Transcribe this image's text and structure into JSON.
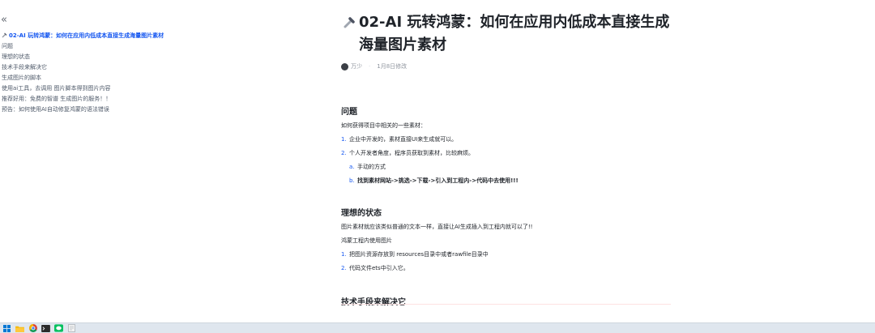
{
  "outline": {
    "collapse_glyph": "«",
    "items": [
      {
        "label": "02-AI 玩转鸿蒙：如何在应用内低成本直接生成海量图片素材"
      },
      {
        "label": "问题"
      },
      {
        "label": "理想的状态"
      },
      {
        "label": "技术手段来解决它"
      },
      {
        "label": "生成图片的脚本"
      },
      {
        "label": "使用ai工具，去调用 图片脚本得到图片内容"
      },
      {
        "label": "推荐好用：免费的智谱 生成图片的服务！！"
      },
      {
        "label": "预告：如何使用AI自动修复鸿蒙的语法错误"
      }
    ]
  },
  "doc": {
    "title": "02-AI 玩转鸿蒙：如何在应用内低成本直接生成海量图片素材",
    "author": "万少",
    "modified": "1月8日修改",
    "sections": {
      "problem": {
        "heading": "问题",
        "intro": "如何获得项目中相关的一些素材：",
        "items": [
          {
            "num": "1.",
            "text": "企业中开发的，素材直接UI来生成就可以。"
          },
          {
            "num": "2.",
            "text": "个人开发者角度，程序员获取到素材，比较麻烦。"
          }
        ],
        "subitems": [
          {
            "num": "a.",
            "text": "手动的方式"
          },
          {
            "num": "b.",
            "text": "找到素材网站->挑选->下载->引入到工程内->代码中去使用!!!"
          }
        ]
      },
      "ideal": {
        "heading": "理想的状态",
        "p1": "图片素材就应该类似普通的文本一样，直接让AI生成插入到工程内就可以了!!",
        "p2": "鸿蒙工程内使用图片",
        "items": [
          {
            "num": "1.",
            "text": "把图片资源存放到 resources目录中或者rawfile目录中"
          },
          {
            "num": "2.",
            "text": "代码文件ets中引入它。"
          }
        ]
      },
      "tech": {
        "heading": "技术手段来解决它"
      }
    }
  },
  "taskbar": {
    "colors": {
      "windows": "#0078d4",
      "explorer": "#f2b705",
      "chrome_red": "#db4437",
      "chrome_green": "#0f9d58",
      "chrome_yellow": "#f4b400",
      "terminal": "#2b2b2b",
      "wechat": "#07c160",
      "note": "#f3f3f3"
    }
  }
}
